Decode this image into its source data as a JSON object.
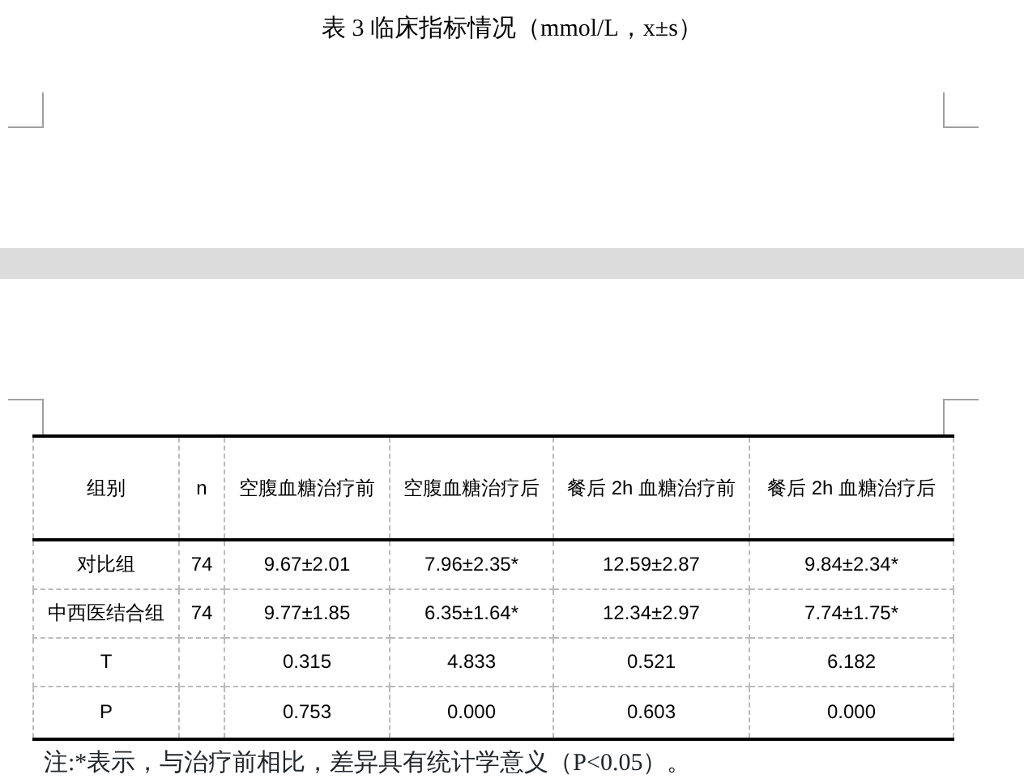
{
  "document_title": "表 3 临床指标情况（mmol/L，x±s）",
  "table": {
    "columns": [
      "组别",
      "n",
      "空腹血糖治疗前",
      "空腹血糖治疗后",
      "餐后 2h 血糖治疗前",
      "餐后 2h 血糖治疗后"
    ],
    "rows": [
      [
        "对比组",
        "74",
        "9.67±2.01",
        "7.96±2.35*",
        "12.59±2.87",
        "9.84±2.34*"
      ],
      [
        "中西医结合组",
        "74",
        "9.77±1.85",
        "6.35±1.64*",
        "12.34±2.97",
        "7.74±1.75*"
      ],
      [
        "T",
        "",
        "0.315",
        "4.833",
        "0.521",
        "6.182"
      ],
      [
        "P",
        "",
        "0.753",
        "0.000",
        "0.603",
        "0.000"
      ]
    ]
  },
  "footnote": "注:*表示，与治疗前相比，差异具有统计学意义（P<0.05）。"
}
